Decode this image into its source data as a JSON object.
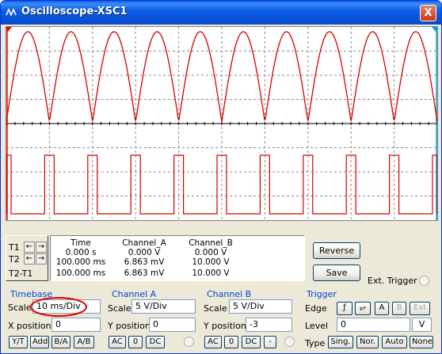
{
  "window": {
    "title": "Oscilloscope-XSC1",
    "close_label": "X"
  },
  "display": {
    "background": "#ffffff",
    "trace_a_color": "#d40000",
    "trace_b_color": "#d40000",
    "grid_color": "#8a8a8a",
    "cursor_1_color": "#ff0000",
    "cursor_2_color": "#00a0e0",
    "channel_a_period_ms": 10,
    "channel_b_period_ms": 10
  },
  "cursors": {
    "t1_label": "T1",
    "t2_label": "T2",
    "t2_t1_label": "T2-T1",
    "left_arrow": "←",
    "right_arrow": "→"
  },
  "measurements": {
    "headers": [
      "Time",
      "Channel_A",
      "Channel_B"
    ],
    "rows": [
      [
        "0.000 s",
        "0.000 V",
        "0.000 V"
      ],
      [
        "100.000 ms",
        "6.863 mV",
        "10.000 V"
      ],
      [
        "100.000 ms",
        "6.863 mV",
        "10.000 V"
      ]
    ]
  },
  "buttons": {
    "reverse": "Reverse",
    "save": "Save"
  },
  "ext_trigger_label": "Ext. Trigger",
  "timebase": {
    "title": "Timebase",
    "scale_label": "Scale",
    "scale_value": "10 ms/Div",
    "xpos_label": "X position",
    "xpos_value": "0",
    "modes": [
      "Y/T",
      "Add",
      "B/A",
      "A/B"
    ]
  },
  "channel_a": {
    "title": "Channel A",
    "scale_label": "Scale",
    "scale_value": "5  V/Div",
    "ypos_label": "Y position",
    "ypos_value": "0",
    "coupling": [
      "AC",
      "0",
      "DC"
    ]
  },
  "channel_b": {
    "title": "Channel B",
    "scale_label": "Scale",
    "scale_value": "5  V/Div",
    "ypos_label": "Y position",
    "ypos_value": "-3",
    "coupling": [
      "AC",
      "0",
      "DC",
      "-"
    ]
  },
  "trigger": {
    "title": "Trigger",
    "edge_label": "Edge",
    "edge_rise": "ƒ",
    "edge_fall": "⥂",
    "source_a": "A",
    "source_b": "B",
    "source_ext": "Ext",
    "level_label": "Level",
    "level_value": "0",
    "level_unit": "V",
    "type_label": "Type",
    "types": [
      "Sing.",
      "Nor.",
      "Auto",
      "None"
    ]
  },
  "annotation_color": "#e00000"
}
